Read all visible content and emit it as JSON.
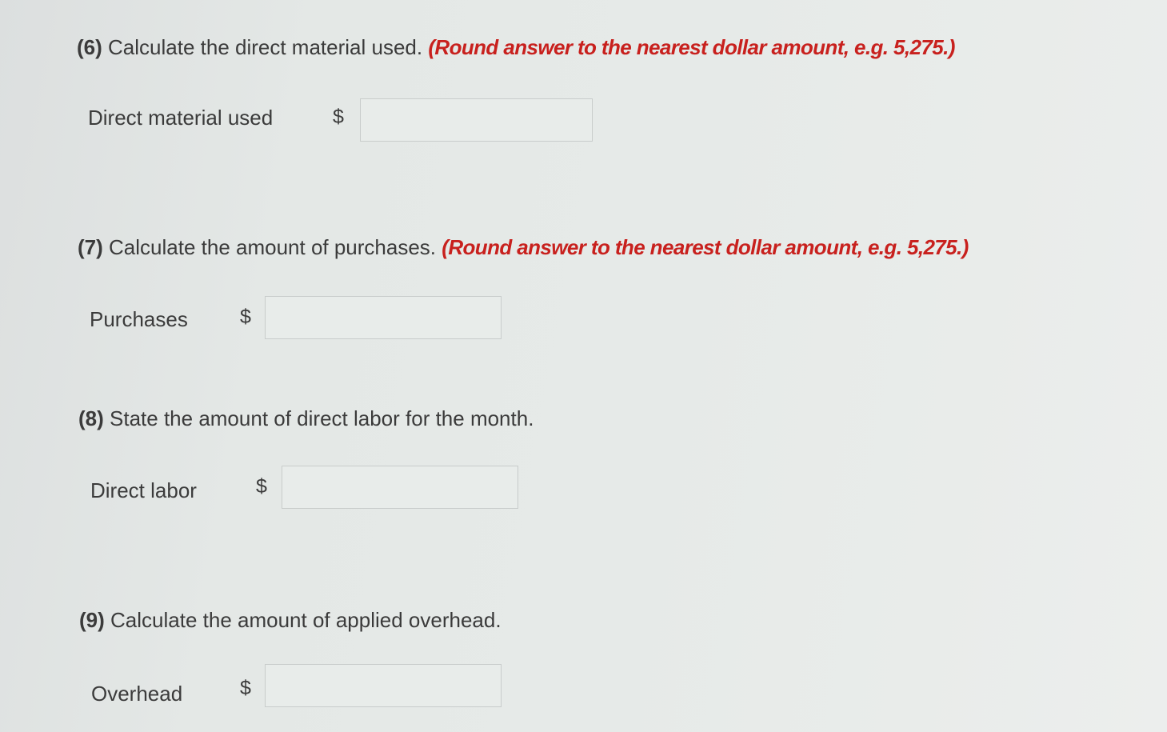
{
  "questions": [
    {
      "number": "(6)",
      "text": "Calculate the direct material used.",
      "note": "(Round answer to the nearest dollar amount, e.g. 5,275.)",
      "field_label": "Direct material used",
      "currency": "$",
      "value": ""
    },
    {
      "number": "(7)",
      "text": "Calculate the amount of purchases.",
      "note": "(Round answer to the nearest dollar amount, e.g. 5,275.)",
      "field_label": "Purchases",
      "currency": "$",
      "value": ""
    },
    {
      "number": "(8)",
      "text": "State the amount of direct labor for the month.",
      "note": "",
      "field_label": "Direct labor",
      "currency": "$",
      "value": ""
    },
    {
      "number": "(9)",
      "text": "Calculate the amount of applied overhead.",
      "note": "",
      "field_label": "Overhead",
      "currency": "$",
      "value": ""
    }
  ],
  "colors": {
    "instruction_red": "#c8211e",
    "text": "#3b3b3b",
    "input_border": "#c8cccb"
  }
}
